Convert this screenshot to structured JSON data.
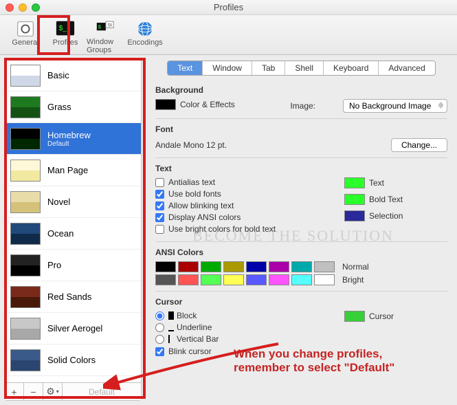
{
  "window": {
    "title": "Profiles"
  },
  "toolbar": {
    "items": [
      {
        "label": "General"
      },
      {
        "label": "Profiles"
      },
      {
        "label": "Window Groups"
      },
      {
        "label": "Encodings"
      }
    ]
  },
  "sidebar": {
    "profiles": [
      {
        "name": "Basic",
        "colors": [
          "#ffffff",
          "#d0d8e8"
        ]
      },
      {
        "name": "Grass",
        "colors": [
          "#1f7a1f",
          "#145214"
        ]
      },
      {
        "name": "Homebrew",
        "subtitle": "Default",
        "colors": [
          "#000000",
          "#002800"
        ],
        "selected": true
      },
      {
        "name": "Man Page",
        "colors": [
          "#fef8d8",
          "#f2e9a0"
        ]
      },
      {
        "name": "Novel",
        "colors": [
          "#e8dca8",
          "#d4c27a"
        ]
      },
      {
        "name": "Ocean",
        "colors": [
          "#204a7a",
          "#102a4a"
        ]
      },
      {
        "name": "Pro",
        "colors": [
          "#222222",
          "#000000"
        ]
      },
      {
        "name": "Red Sands",
        "colors": [
          "#7a2a1a",
          "#4a1808"
        ]
      },
      {
        "name": "Silver Aerogel",
        "colors": [
          "#c8c8c8",
          "#a8a8a8"
        ]
      },
      {
        "name": "Solid Colors",
        "colors": [
          "#3a5a8a",
          "#2a4570"
        ]
      }
    ],
    "footer": {
      "plus": "+",
      "minus": "−",
      "gear": "✱",
      "default": "Default"
    }
  },
  "tabs": [
    "Text",
    "Window",
    "Tab",
    "Shell",
    "Keyboard",
    "Advanced"
  ],
  "background": {
    "heading": "Background",
    "color_effects": "Color & Effects",
    "image_label": "Image:",
    "image_value": "No Background Image"
  },
  "font": {
    "heading": "Font",
    "value": "Andale Mono 12 pt.",
    "change": "Change..."
  },
  "text": {
    "heading": "Text",
    "antialias": "Antialias text",
    "bold": "Use bold fonts",
    "blink": "Allow blinking text",
    "ansi": "Display ANSI colors",
    "bright": "Use bright colors for bold text",
    "text_label": "Text",
    "bold_label": "Bold Text",
    "selection_label": "Selection",
    "swatches": {
      "text": "#2aff2a",
      "bold": "#2aff2a",
      "selection": "#2a2a9a"
    }
  },
  "ansi": {
    "heading": "ANSI Colors",
    "normal_label": "Normal",
    "bright_label": "Bright",
    "normal": [
      "#000000",
      "#aa0000",
      "#00aa00",
      "#aa9a00",
      "#0000aa",
      "#aa00aa",
      "#00aaaa",
      "#c0c0c0"
    ],
    "bright": [
      "#555555",
      "#ff5555",
      "#55ff55",
      "#ffff55",
      "#5a5aff",
      "#ff55ff",
      "#55ffff",
      "#ffffff"
    ]
  },
  "cursor": {
    "heading": "Cursor",
    "block": "Block",
    "underline": "Underline",
    "vertical": "Vertical Bar",
    "blink": "Blink cursor",
    "cursor_label": "Cursor",
    "swatch": "#38d038"
  },
  "annotation": {
    "line1": "When you change profiles,",
    "line2": "remember to select \"Default\""
  },
  "watermark": "BECOME THE SOLUTION"
}
